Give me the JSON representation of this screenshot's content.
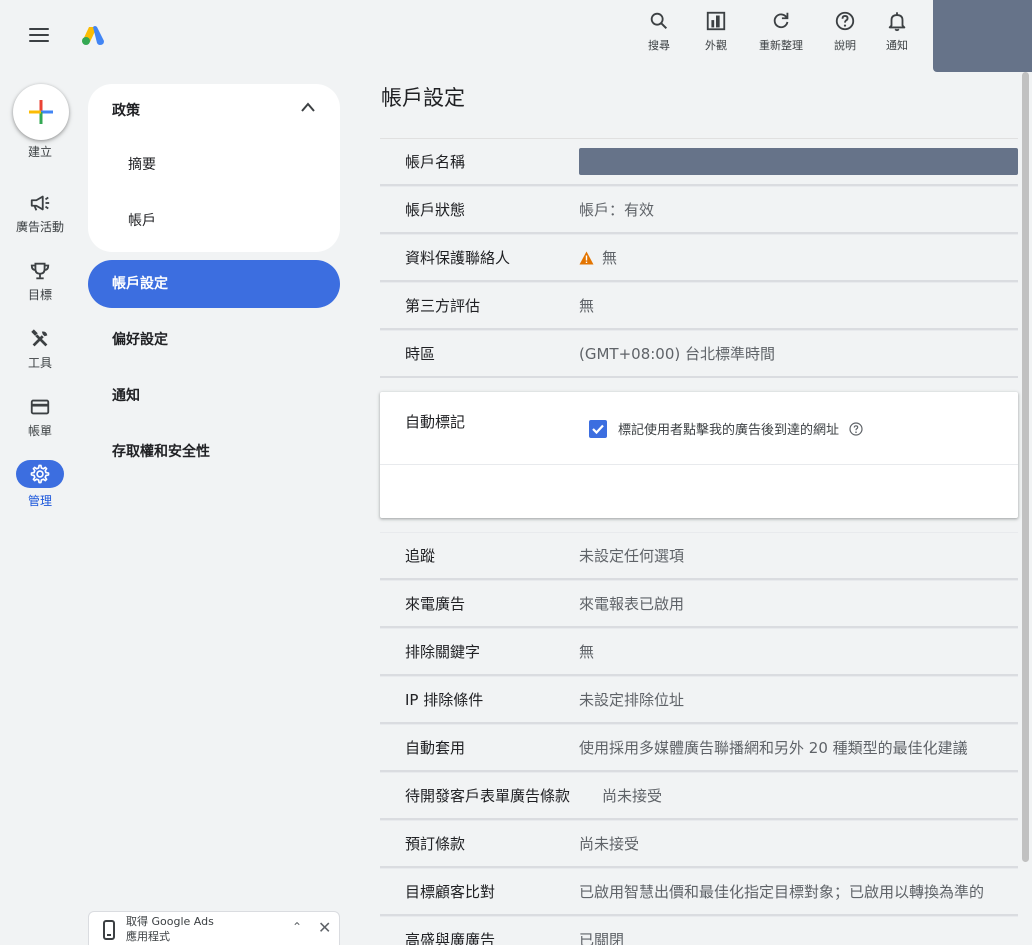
{
  "topbar": {
    "actions": [
      {
        "id": "search",
        "label": "搜尋",
        "icon": "search-icon"
      },
      {
        "id": "appearance",
        "label": "外觀",
        "icon": "appearance-icon"
      },
      {
        "id": "refresh",
        "label": "重新整理",
        "icon": "refresh-icon"
      },
      {
        "id": "help",
        "label": "說明",
        "icon": "help-icon"
      },
      {
        "id": "notifications",
        "label": "通知",
        "icon": "bell-icon"
      }
    ]
  },
  "rail": {
    "create_label": "建立",
    "items": [
      {
        "label": "廣告活動",
        "icon": "megaphone-icon"
      },
      {
        "label": "目標",
        "icon": "trophy-icon"
      },
      {
        "label": "工具",
        "icon": "tools-icon"
      },
      {
        "label": "帳單",
        "icon": "credit-card-icon"
      },
      {
        "label": "管理",
        "icon": "gear-icon",
        "active": true
      }
    ]
  },
  "nav": {
    "section_title": "政策",
    "sub_items": [
      "摘要",
      "帳戶"
    ],
    "items": [
      "帳戶設定",
      "偏好設定",
      "通知",
      "存取權和安全性"
    ],
    "selected_index": 0
  },
  "app_promo": {
    "line1": "取得 Google Ads",
    "line2": "應用程式"
  },
  "main": {
    "title": "帳戶設定",
    "rows": [
      {
        "key": "帳戶名稱",
        "value": ""
      },
      {
        "key": "帳戶狀態",
        "value": "帳戶：有效"
      },
      {
        "key": "資料保護聯絡人",
        "value": "無"
      },
      {
        "key": "第三方評估",
        "value": "無"
      },
      {
        "key": "時區",
        "value": "(GMT+08:00) 台北標準時間"
      }
    ],
    "auto_tagging": {
      "key": "自動標記",
      "checkbox_label": "標記使用者點擊我的廣告後到達的網址",
      "checked": true
    },
    "rows2": [
      {
        "key": "追蹤",
        "value": "未設定任何選項"
      },
      {
        "key": "來電廣告",
        "value": "來電報表已啟用"
      },
      {
        "key": "排除關鍵字",
        "value": "無"
      },
      {
        "key": "IP 排除條件",
        "value": "未設定排除位址"
      },
      {
        "key": "自動套用",
        "value": "使用採用多媒體廣告聯播網和另外 20 種類型的最佳化建議"
      },
      {
        "key": "待開發客戶表單廣告條款",
        "value": "尚未接受"
      },
      {
        "key": "預訂條款",
        "value": "尚未接受"
      },
      {
        "key": "目標顧客比對",
        "value": "已啟用智慧出價和最佳化指定目標對象；已啟用以轉換為準的"
      },
      {
        "key": "高盛與廣廣告",
        "value": "已關閉"
      }
    ]
  },
  "colors": {
    "accent": "#3c6ee0",
    "redacted": "#667389",
    "warning": "#e37400"
  }
}
